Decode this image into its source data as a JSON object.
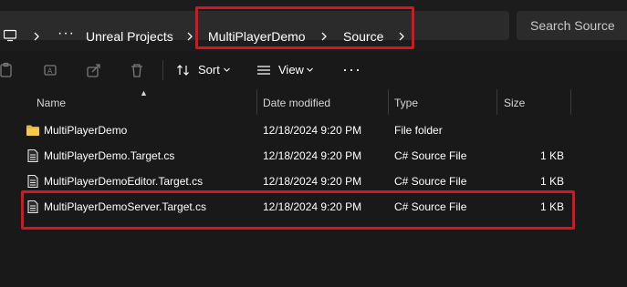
{
  "breadcrumb": {
    "overflow": "···",
    "items": [
      "Unreal Projects",
      "MultiPlayerDemo",
      "Source"
    ]
  },
  "search": {
    "placeholder": "Search Source"
  },
  "toolbar": {
    "sort_label": "Sort",
    "view_label": "View",
    "more_label": "···"
  },
  "columns": {
    "name": "Name",
    "date": "Date modified",
    "type": "Type",
    "size": "Size"
  },
  "files": [
    {
      "name": "MultiPlayerDemo",
      "date": "12/18/2024 9:20 PM",
      "type": "File folder",
      "size": "",
      "icon": "folder-icon"
    },
    {
      "name": "MultiPlayerDemo.Target.cs",
      "date": "12/18/2024 9:20 PM",
      "type": "C# Source File",
      "size": "1 KB",
      "icon": "file-icon"
    },
    {
      "name": "MultiPlayerDemoEditor.Target.cs",
      "date": "12/18/2024 9:20 PM",
      "type": "C# Source File",
      "size": "1 KB",
      "icon": "file-icon"
    },
    {
      "name": "MultiPlayerDemoServer.Target.cs",
      "date": "12/18/2024 9:20 PM",
      "type": "C# Source File",
      "size": "1 KB",
      "icon": "file-icon"
    }
  ],
  "colors": {
    "highlight": "#d8141c",
    "folder": "#e8b53a",
    "background": "#191919"
  }
}
